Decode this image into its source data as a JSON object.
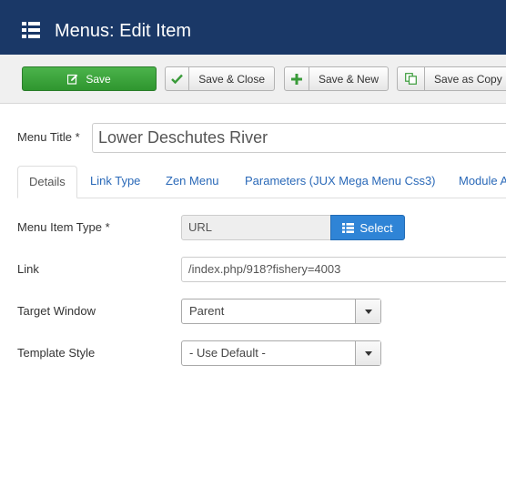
{
  "header": {
    "title": "Menus: Edit Item"
  },
  "toolbar": {
    "save": "Save",
    "save_close": "Save & Close",
    "save_new": "Save & New",
    "save_copy": "Save as Copy"
  },
  "form": {
    "menu_title_label": "Menu Title *",
    "menu_title_value": "Lower Deschutes River"
  },
  "tabs": [
    {
      "label": "Details",
      "active": true
    },
    {
      "label": "Link Type"
    },
    {
      "label": "Zen Menu"
    },
    {
      "label": "Parameters (JUX Mega Menu Css3)"
    },
    {
      "label": "Module A"
    }
  ],
  "details": {
    "menu_item_type_label": "Menu Item Type *",
    "menu_item_type_value": "URL",
    "select_button": "Select",
    "link_label": "Link",
    "link_value": "/index.php/918?fishery=4003",
    "target_window_label": "Target Window",
    "target_window_value": "Parent",
    "template_style_label": "Template Style",
    "template_style_value": "- Use Default -"
  },
  "colors": {
    "header_bg": "#1a3867",
    "save_green": "#3aa53a",
    "primary_blue": "#2f84d6",
    "link_blue": "#2a69b8"
  }
}
